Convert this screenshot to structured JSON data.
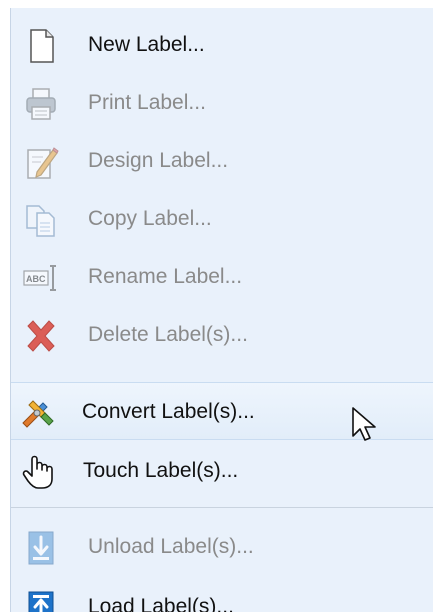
{
  "menu": {
    "items": [
      {
        "label": "New Label...",
        "icon": "new-document-icon",
        "enabled": true
      },
      {
        "label": "Print Label...",
        "icon": "printer-icon",
        "enabled": false
      },
      {
        "label": "Design Label...",
        "icon": "pencil-document-icon",
        "enabled": false
      },
      {
        "label": "Copy Label...",
        "icon": "copy-documents-icon",
        "enabled": false
      },
      {
        "label": "Rename Label...",
        "icon": "rename-abc-icon",
        "enabled": false
      },
      {
        "label": "Delete Label(s)...",
        "icon": "delete-x-icon",
        "enabled": false
      },
      {
        "label": "Convert Label(s)...",
        "icon": "convert-icon",
        "enabled": true,
        "hovered": true
      },
      {
        "label": "Touch Label(s)...",
        "icon": "hand-pointer-icon",
        "enabled": true
      },
      {
        "label": "Unload Label(s)...",
        "icon": "unload-down-arrow-icon",
        "enabled": false
      },
      {
        "label": "Load Label(s)...",
        "icon": "load-up-arrow-icon",
        "enabled": true
      }
    ]
  },
  "colors": {
    "menu_background": "#e9f1fb",
    "enabled_text": "#111111",
    "disabled_text": "#8a8a8a",
    "hover_background": "#e4effb",
    "delete_red": "#d9453b",
    "arrow_blue": "#1e73c9"
  }
}
